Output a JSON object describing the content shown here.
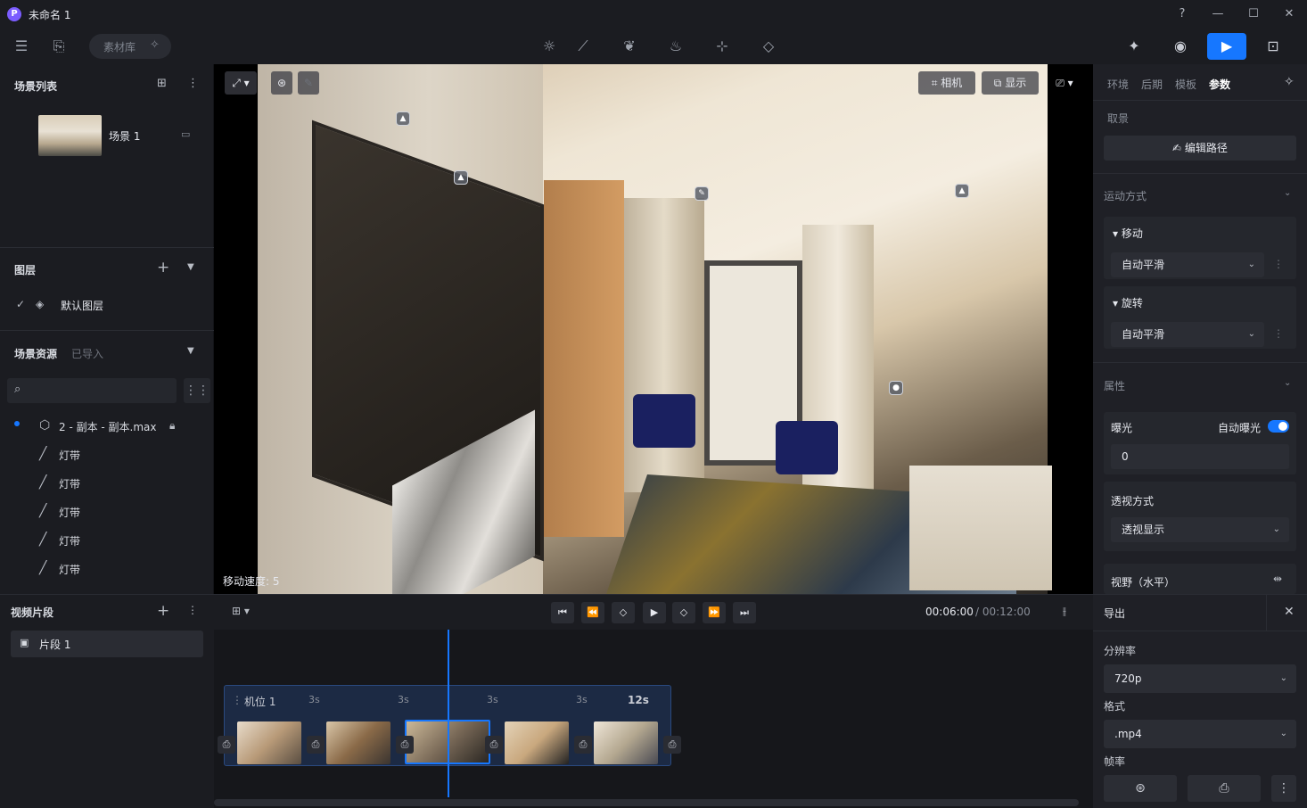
{
  "window": {
    "logo": "P",
    "title": "未命名 1"
  },
  "toolbar": {
    "material_label": "素材库"
  },
  "scene_list": {
    "title": "场景列表",
    "scene_name": "场景 1"
  },
  "layers": {
    "title": "图层",
    "default_layer": "默认图层"
  },
  "assets": {
    "title": "场景资源",
    "imported_tab": "已导入",
    "search_placeholder": "",
    "model_file": "2 - 副本 - 副本.max",
    "items": [
      "灯带",
      "灯带",
      "灯带",
      "灯带",
      "灯带"
    ]
  },
  "clips": {
    "title": "视频片段",
    "clip_name": "片段 1"
  },
  "viewport": {
    "camera_btn": "相机",
    "display_btn": "显示",
    "speed_text": "移动速度: 5"
  },
  "right_panel": {
    "tabs": [
      "环境",
      "后期",
      "模板",
      "参数"
    ],
    "active_tab": "参数",
    "framing_label": "取景",
    "edit_path_btn": "编辑路径",
    "motion_title": "运动方式",
    "move_label": "移动",
    "move_value": "自动平滑",
    "rotate_label": "旋转",
    "rotate_value": "自动平滑",
    "attr_title": "属性",
    "exposure_label": "曝光",
    "auto_exposure_label": "自动曝光",
    "auto_exposure_on": true,
    "exposure_value": "0",
    "perspective_label": "透视方式",
    "perspective_value": "透视显示",
    "fov_label": "视野（水平）"
  },
  "timeline": {
    "current_time": "00:06:00",
    "total_time": "/ 00:12:00",
    "track_name": "机位 1",
    "segments": [
      "3s",
      "3s",
      "3s",
      "3s"
    ],
    "total_duration": "12s"
  },
  "export": {
    "title": "导出",
    "resolution_label": "分辨率",
    "resolution_value": "720p",
    "format_label": "格式",
    "format_value": ".mp4",
    "fps_label": "帧率"
  },
  "colors": {
    "accent": "#1677ff",
    "panel": "#1f2026",
    "background": "#1b1c21"
  }
}
